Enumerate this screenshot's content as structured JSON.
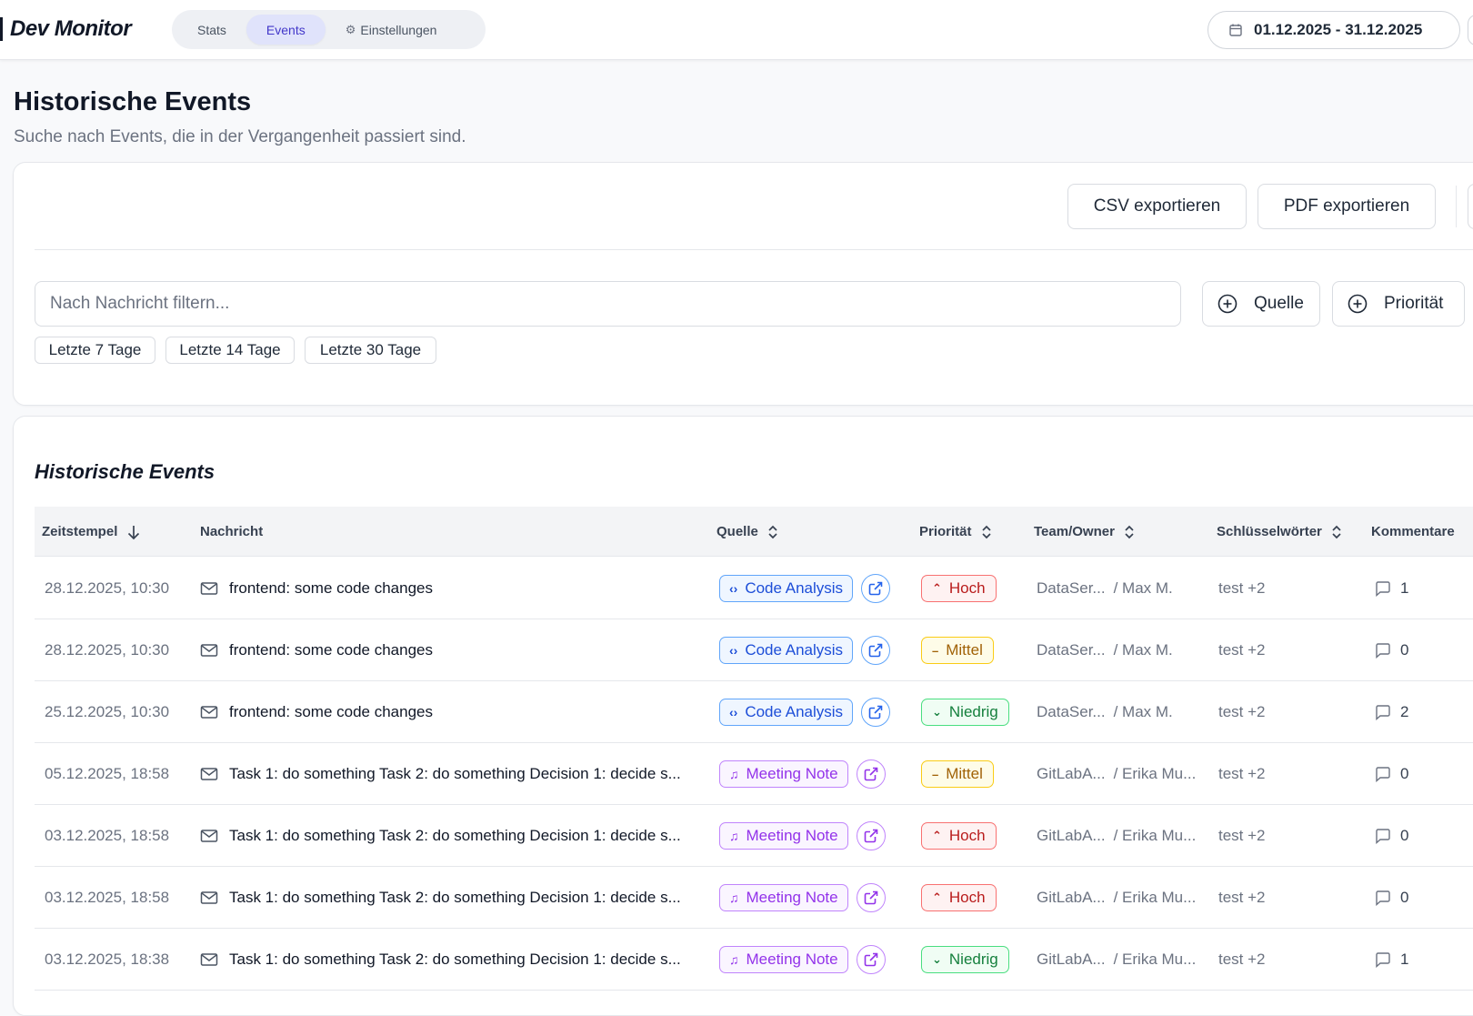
{
  "app": {
    "title": "Dev Monitor",
    "nav": [
      {
        "label": "Stats",
        "active": false
      },
      {
        "label": "Events",
        "active": true
      },
      {
        "label": "Einstellungen",
        "active": false,
        "icon": "gear-icon"
      }
    ],
    "date_range": "01.12.2025 - 31.12.2025"
  },
  "page": {
    "title": "Historische Events",
    "subtitle": "Suche nach Events, die in der Vergangenheit passiert sind."
  },
  "toolbar": {
    "csv_label": "CSV exportieren",
    "pdf_label": "PDF exportieren"
  },
  "filters": {
    "search_placeholder": "Nach Nachricht filtern...",
    "source_label": "Quelle",
    "priority_label": "Priorität",
    "quick_ranges": [
      "Letzte 7 Tage",
      "Letzte 14 Tage",
      "Letzte 30 Tage"
    ]
  },
  "table": {
    "title": "Historische Events",
    "columns": {
      "timestamp": "Zeitstempel",
      "message": "Nachricht",
      "source": "Quelle",
      "priority": "Priorität",
      "team": "Team/Owner",
      "keywords": "Schlüsselwörter",
      "comments": "Kommentare"
    },
    "rows": [
      {
        "time": "28.12.2025, 10:30",
        "message": "frontend: some code changes",
        "source": "Code Analysis",
        "source_type": "code",
        "priority": "Hoch",
        "priority_level": "hoch",
        "team": "DataSer...",
        "owner": "/ Max M.",
        "keywords": "test +2",
        "comments": "1"
      },
      {
        "time": "28.12.2025, 10:30",
        "message": "frontend: some code changes",
        "source": "Code Analysis",
        "source_type": "code",
        "priority": "Mittel",
        "priority_level": "mittel",
        "team": "DataSer...",
        "owner": "/ Max M.",
        "keywords": "test +2",
        "comments": "0"
      },
      {
        "time": "25.12.2025, 10:30",
        "message": "frontend: some code changes",
        "source": "Code Analysis",
        "source_type": "code",
        "priority": "Niedrig",
        "priority_level": "niedrig",
        "team": "DataSer...",
        "owner": "/ Max M.",
        "keywords": "test +2",
        "comments": "2"
      },
      {
        "time": "05.12.2025, 18:58",
        "message": "Task 1: do something Task 2: do something Decision 1: decide s...",
        "source": "Meeting Note",
        "source_type": "meet",
        "priority": "Mittel",
        "priority_level": "mittel",
        "team": "GitLabA...",
        "owner": "/ Erika Mu...",
        "keywords": "test +2",
        "comments": "0"
      },
      {
        "time": "03.12.2025, 18:58",
        "message": "Task 1: do something Task 2: do something Decision 1: decide s...",
        "source": "Meeting Note",
        "source_type": "meet",
        "priority": "Hoch",
        "priority_level": "hoch",
        "team": "GitLabA...",
        "owner": "/ Erika Mu...",
        "keywords": "test +2",
        "comments": "0"
      },
      {
        "time": "03.12.2025, 18:58",
        "message": "Task 1: do something Task 2: do something Decision 1: decide s...",
        "source": "Meeting Note",
        "source_type": "meet",
        "priority": "Hoch",
        "priority_level": "hoch",
        "team": "GitLabA...",
        "owner": "/ Erika Mu...",
        "keywords": "test +2",
        "comments": "0"
      },
      {
        "time": "03.12.2025, 18:38",
        "message": "Task 1: do something Task 2: do something Decision 1: decide s...",
        "source": "Meeting Note",
        "source_type": "meet",
        "priority": "Niedrig",
        "priority_level": "niedrig",
        "team": "GitLabA...",
        "owner": "/ Erika Mu...",
        "keywords": "test +2",
        "comments": "1"
      }
    ]
  }
}
